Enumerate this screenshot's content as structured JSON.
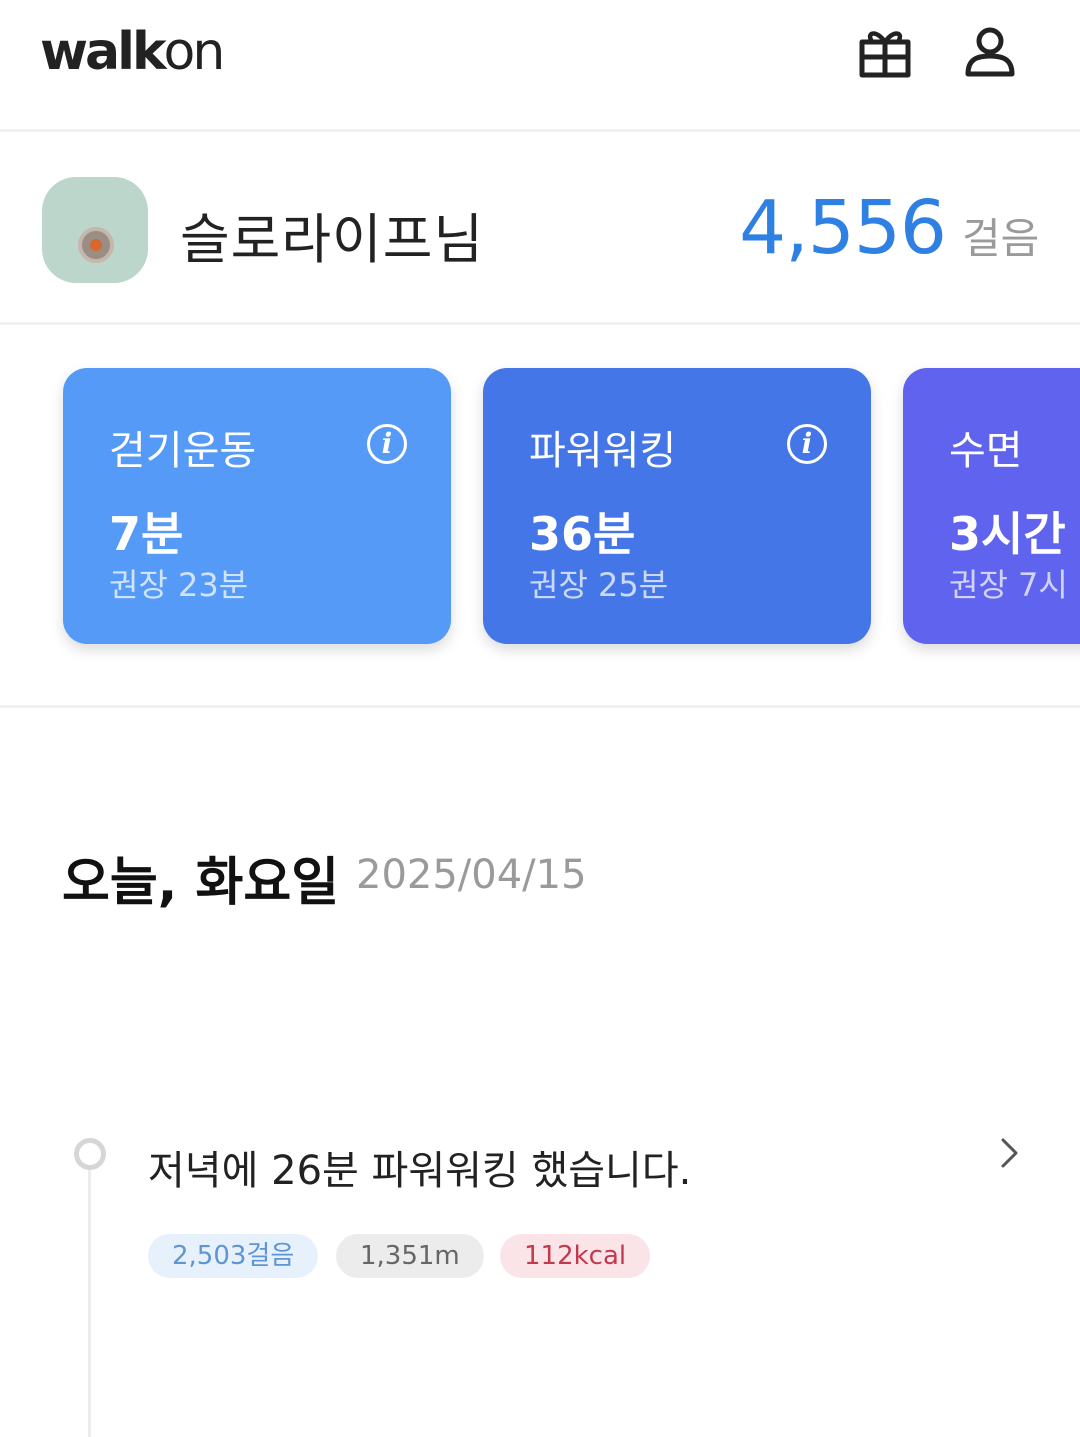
{
  "header": {
    "logo_bold": "walk",
    "logo_thin": "on",
    "icons": [
      "gift-icon",
      "user-icon"
    ]
  },
  "profile": {
    "name": "슬로라이프님",
    "steps": "4,556",
    "steps_unit": "걸음"
  },
  "cards": [
    {
      "title": "걷기운동",
      "value": "7분",
      "recommended": "권장 23분",
      "has_info": true,
      "color": "#559af6"
    },
    {
      "title": "파워워킹",
      "value": "36분",
      "recommended": "권장 25분",
      "has_info": true,
      "color": "#4476e8"
    },
    {
      "title": "수면",
      "value": "3시간",
      "recommended": "권장 7시",
      "has_info": false,
      "color": "#5f63ee"
    }
  ],
  "info_glyph": "i",
  "today": {
    "label": "오늘, 화요일",
    "date": "2025/04/15"
  },
  "activity": {
    "text": "저녁에 26분 파워워킹 했습니다.",
    "steps_chip": "2,503걸음",
    "distance_chip": "1,351m",
    "calories_chip": "112kcal"
  },
  "colors": {
    "accent": "#2f80e3",
    "steps_chip_bg": "#e7f1fb",
    "calories_text": "#c13a4e"
  }
}
